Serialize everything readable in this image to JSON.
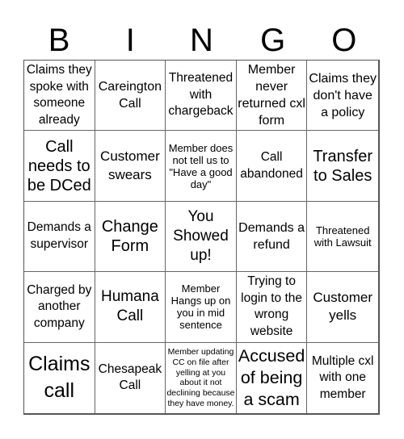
{
  "header": {
    "letters": [
      "B",
      "I",
      "N",
      "G",
      "O"
    ]
  },
  "board": {
    "rows": [
      [
        "Claims they spoke with someone already",
        "Careington Call",
        "Threatened with chargeback",
        "Member never returned cxl form",
        "Claims they don't have a policy"
      ],
      [
        "Call needs to be DCed",
        "Customer swears",
        "Member does not tell us to \"Have a good day\"",
        "Call abandoned",
        "Transfer to Sales"
      ],
      [
        "Demands a supervisor",
        "Change Form",
        "You Showed up!",
        "Demands a refund",
        "Threatened with Lawsuit"
      ],
      [
        "Charged by another company",
        "Humana Call",
        "Member Hangs up on you in mid sentence",
        "Trying to login to the wrong website",
        "Customer yells"
      ],
      [
        "Claims call",
        "Chesapeak Call",
        "Member updating CC on file after yelling at you about it not declining because they have money.",
        "Accused of being a scam",
        "Multiple cxl with one member"
      ]
    ]
  },
  "colors": {
    "text": "#000000",
    "grid_line": "#666666",
    "background": "#ffffff"
  }
}
